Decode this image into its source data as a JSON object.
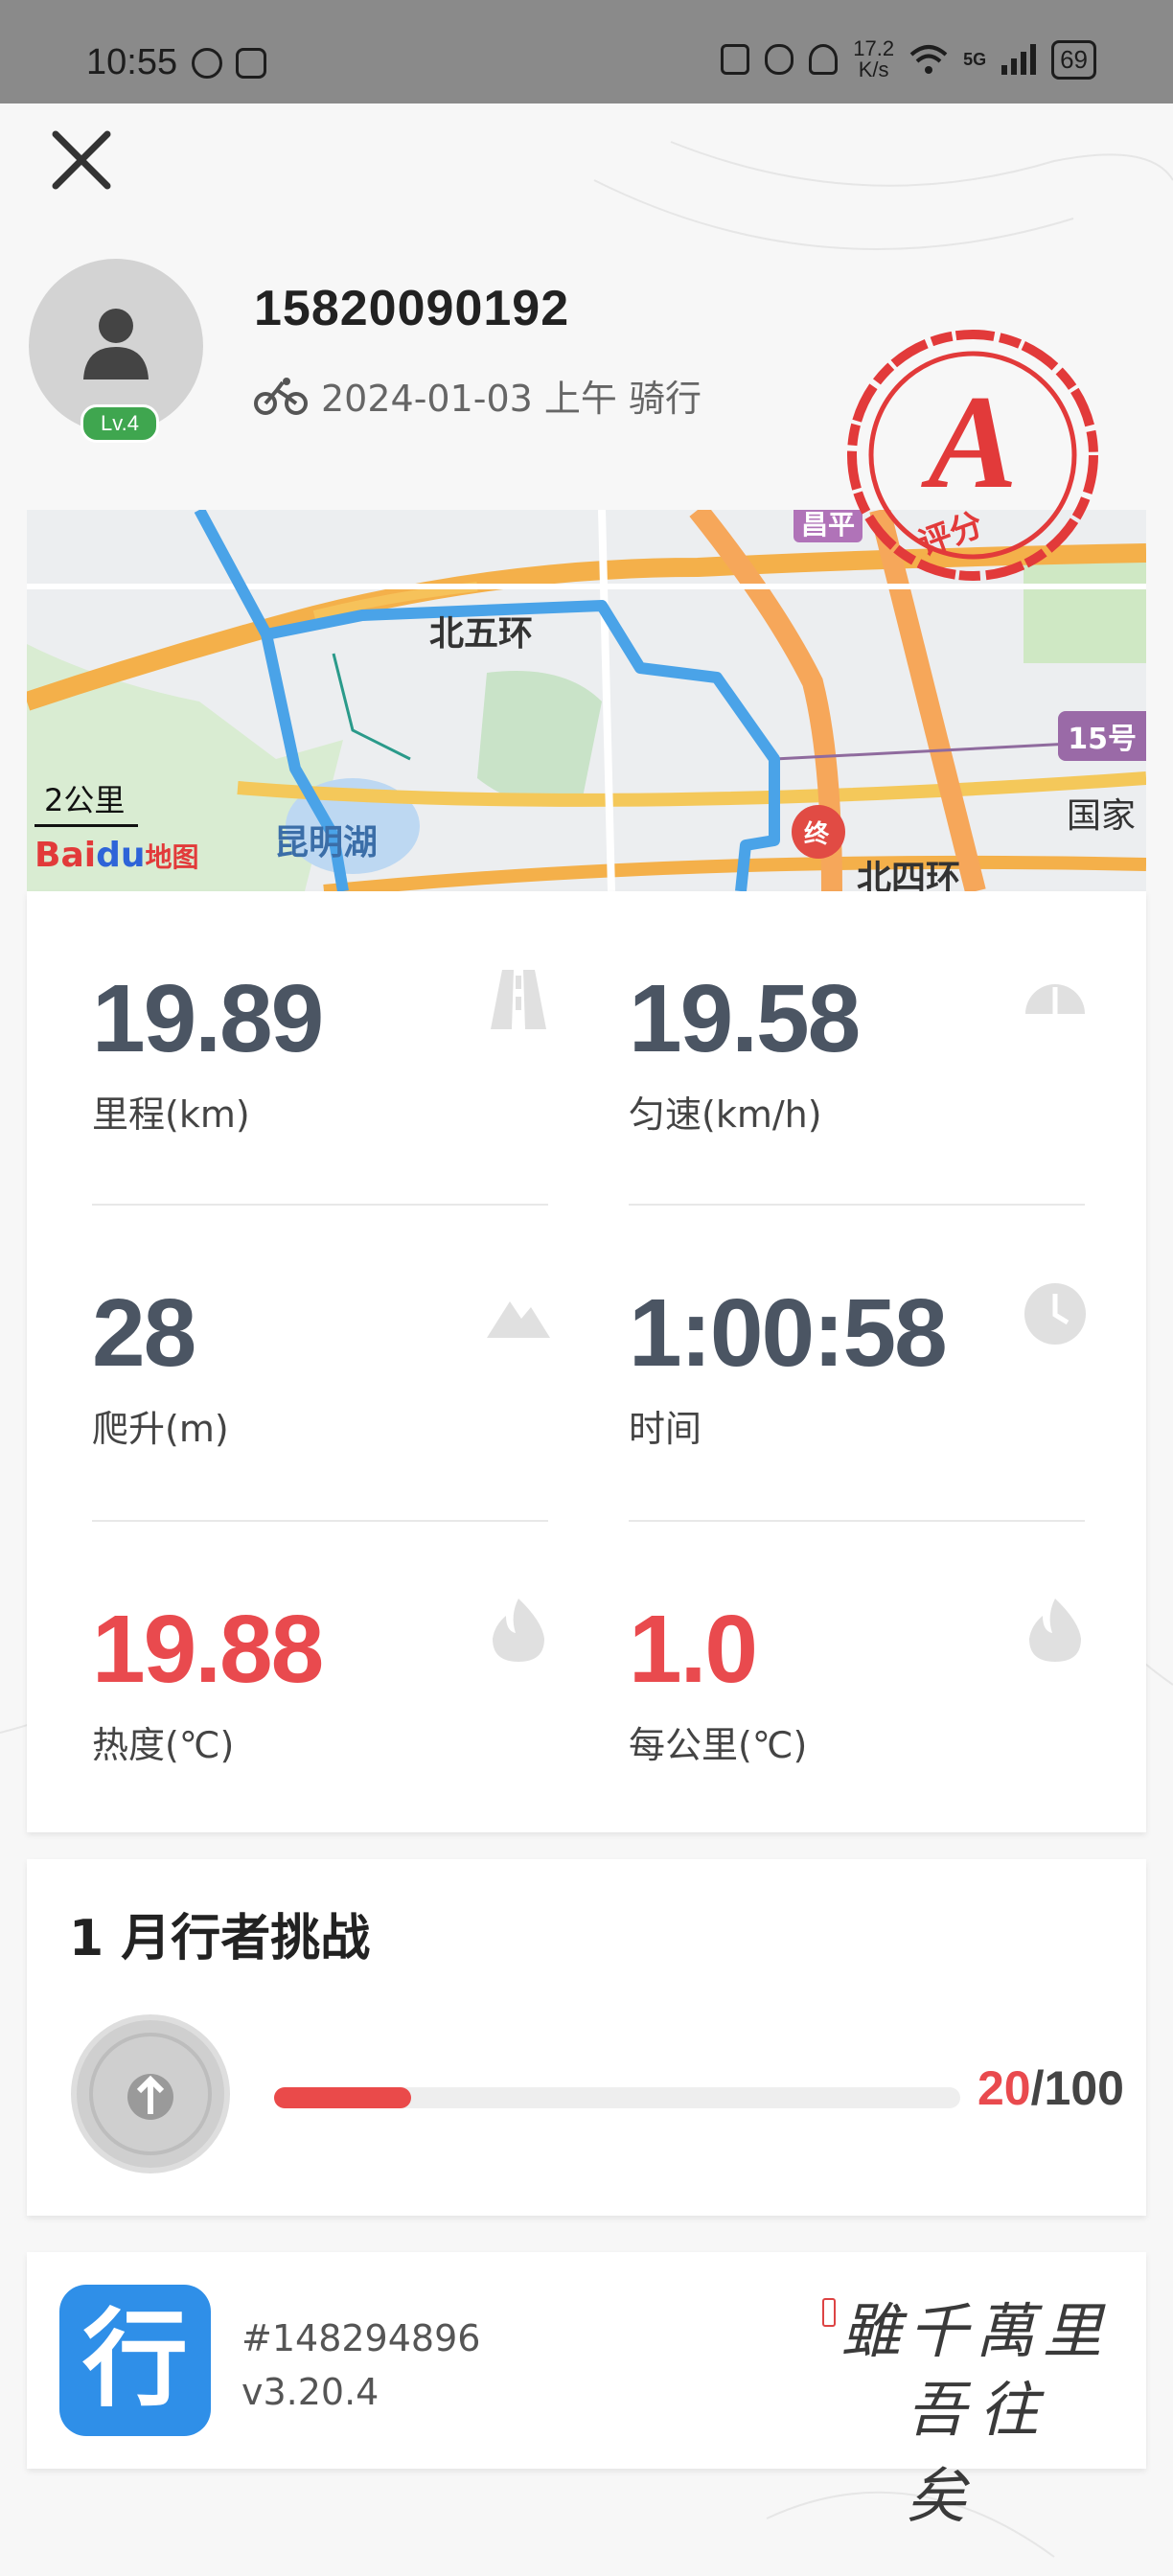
{
  "status_bar": {
    "time": "10:55",
    "net_speed_value": "17.2",
    "net_speed_unit": "K/s",
    "signal": "5G",
    "battery": "69"
  },
  "profile": {
    "username": "15820090192",
    "level_badge": "Lv.4",
    "activity_line": "2024-01-03 上午 骑行",
    "activity_icon": "bicycle-icon",
    "rating_stamp_grade": "A",
    "rating_stamp_label": "评分"
  },
  "map": {
    "labels": {
      "north_fifth_ring": "北五环",
      "kunming_lake": "昆明湖",
      "north_fourth_ring": "北四环",
      "guojia": "国家",
      "top_partial": "昌平",
      "route_15": "15号",
      "end_marker": "终"
    },
    "scale": "2公里",
    "provider_logo": {
      "bai": "Bai",
      "du": "du",
      "ditu": "地图"
    },
    "route_color": "#4aa3e8"
  },
  "stats": [
    {
      "value": "19.89",
      "label": "里程(km)",
      "icon": "road-icon",
      "highlight": false
    },
    {
      "value": "19.58",
      "label": "匀速(km/h)",
      "icon": "speedometer-icon",
      "highlight": false
    },
    {
      "value": "28",
      "label": "爬升(m)",
      "icon": "mountain-icon",
      "highlight": false
    },
    {
      "value": "1:00:58",
      "label": "时间",
      "icon": "clock-icon",
      "highlight": false
    },
    {
      "value": "19.88",
      "label": "热度(℃)",
      "icon": "flame-icon",
      "highlight": true
    },
    {
      "value": "1.0",
      "label": "每公里(℃)",
      "icon": "flame-icon",
      "highlight": true
    }
  ],
  "challenge": {
    "title": "1 月行者挑战",
    "current": "20",
    "total": "/100",
    "progress_fraction": 0.2
  },
  "footer": {
    "app_icon_char": "行",
    "record_id": "#148294896",
    "version": "v3.20.4",
    "calligraphy_line1": "雖千萬里",
    "calligraphy_line2": "吾往矣"
  },
  "colors": {
    "accent_red": "#e94a4e",
    "stat_gray": "#4b5563",
    "level_green": "#3fa64f",
    "app_blue": "#2f8fe8"
  }
}
